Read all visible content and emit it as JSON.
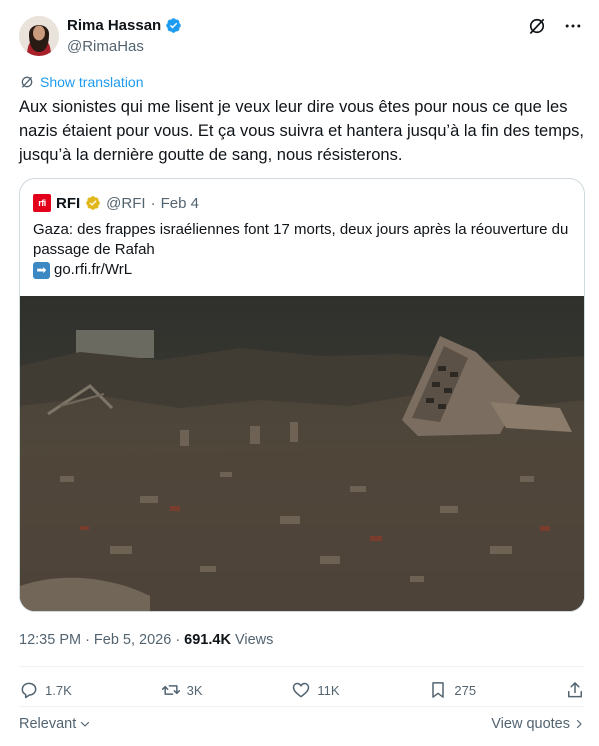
{
  "author": {
    "name": "Rima Hassan",
    "handle": "@RimaHas"
  },
  "translate": {
    "label": "Show translation"
  },
  "tweet": {
    "text": "Aux sionistes qui me lisent je veux leur dire vous êtes pour nous ce que les nazis étaient pour vous. Et ça vous suivra et hantera jusqu’à la fin des temps, jusqu’à la dernière goutte de sang, nous résisterons."
  },
  "quote": {
    "name": "RFI",
    "handle": "@RFI",
    "date": "Feb 4",
    "logo_text": "rfi",
    "text": "Gaza: des frappes israéliennes font 17 morts, deux jours après la réouverture du passage de Rafah",
    "link": "go.rfi.fr/WrL",
    "link_icon": "➡"
  },
  "meta": {
    "time": "12:35 PM",
    "date": "Feb 5, 2026",
    "views_count": "691.4K",
    "views_label": "Views"
  },
  "actions": {
    "replies": "1.7K",
    "reposts": "3K",
    "likes": "11K",
    "bookmarks": "275"
  },
  "bottom": {
    "relevant": "Relevant",
    "view_quotes": "View quotes"
  },
  "icons": {
    "verified": "verified-badge-icon",
    "grok": "grok-icon",
    "more": "more-icon",
    "translate": "translate-icon",
    "reply": "reply-icon",
    "repost": "repost-icon",
    "like": "heart-icon",
    "bookmark": "bookmark-icon",
    "share": "share-icon"
  },
  "colors": {
    "accent": "#1d9bf0",
    "secondary_text": "#536471",
    "rfi_red": "#e2001a",
    "gold_check": "#e2b719"
  }
}
